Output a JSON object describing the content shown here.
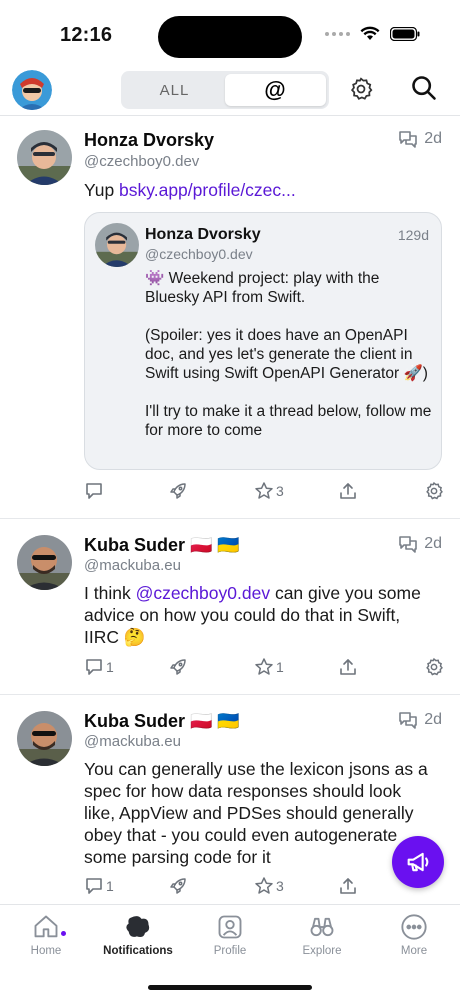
{
  "status_bar": {
    "time": "12:16"
  },
  "header": {
    "segments": [
      {
        "label": "ALL"
      },
      {
        "label": "@"
      }
    ]
  },
  "posts": [
    {
      "author": "Honza Dvorsky",
      "handle": "@czechboy0.dev",
      "time": "2d",
      "text_prefix": "Yup ",
      "link": "bsky.app/profile/czec...",
      "quote": {
        "author": "Honza Dvorsky",
        "handle": "@czechboy0.dev",
        "time": "129d",
        "text": "👾 Weekend project: play with the Bluesky API from Swift.\n\n(Spoiler: yes it does have an OpenAPI doc, and yes let's generate the client in Swift using Swift OpenAPI Generator 🚀)\n\nI'll try to make it a thread below, follow me for more to come"
      },
      "stats": {
        "replies": "",
        "reposts": "",
        "likes": "3"
      }
    },
    {
      "author": "Kuba Suder 🇵🇱 🇺🇦",
      "handle": "@mackuba.eu",
      "time": "2d",
      "text_prefix": "I think ",
      "mention": "@czechboy0.dev",
      "text_suffix": " can give you some advice on how you could do that in Swift, IIRC 🤔",
      "stats": {
        "replies": "1",
        "reposts": "",
        "likes": "1"
      }
    },
    {
      "author": "Kuba Suder 🇵🇱 🇺🇦",
      "handle": "@mackuba.eu",
      "time": "2d",
      "text": "You can generally use the lexicon jsons as a spec for how data responses should look like, AppView and PDSes should generally obey that - you could even autogenerate some parsing code for it",
      "stats": {
        "replies": "1",
        "reposts": "",
        "likes": "3"
      }
    }
  ],
  "tabs": [
    {
      "label": "Home"
    },
    {
      "label": "Notifications"
    },
    {
      "label": "Profile"
    },
    {
      "label": "Explore"
    },
    {
      "label": "More"
    }
  ],
  "colors": {
    "accent": "#6a10f0",
    "link": "#5a18d6",
    "muted": "#7a8089"
  }
}
